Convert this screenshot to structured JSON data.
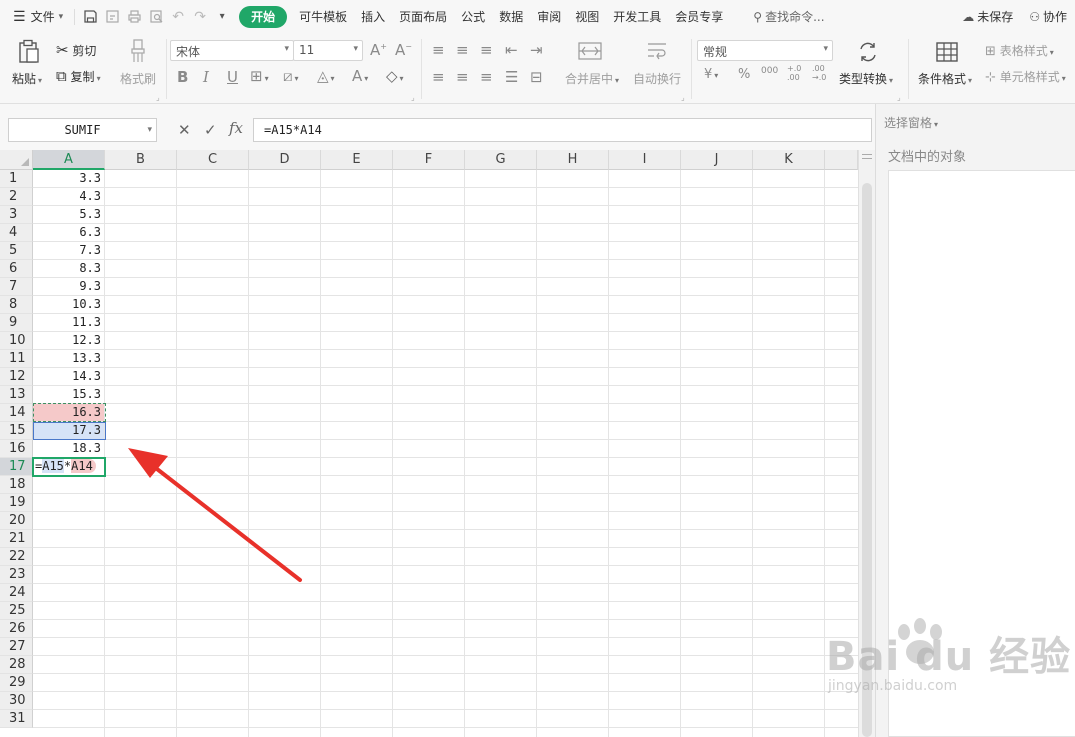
{
  "menu": {
    "file": "文件",
    "tabs": [
      "开始",
      "可牛模板",
      "插入",
      "页面布局",
      "公式",
      "数据",
      "审阅",
      "视图",
      "开发工具",
      "会员专享"
    ],
    "active_tab": "开始",
    "search": "查找命令...",
    "unsaved": "未保存",
    "collab": "协作"
  },
  "ribbon": {
    "paste": "粘贴",
    "cut": "剪切",
    "copy": "复制",
    "format_painter": "格式刷",
    "font_name": "宋体",
    "font_size": "11",
    "merge_center": "合并居中",
    "wrap_text": "自动换行",
    "number_format": "常规",
    "type_convert": "类型转换",
    "cond_format": "条件格式",
    "table_style": "表格样式",
    "cell_style": "单元格样式",
    "currency": "¥",
    "percent": "%",
    "thousands": "000",
    "inc_decimal": "+.0 .00",
    "dec_decimal": ".00 →.0"
  },
  "formula_bar": {
    "name_box": "SUMIF",
    "formula": "=A15*A14",
    "fx": "fx"
  },
  "sheet": {
    "columns": [
      "A",
      "B",
      "C",
      "D",
      "E",
      "F",
      "G",
      "H",
      "I",
      "J",
      "K"
    ],
    "rows": [
      "1",
      "2",
      "3",
      "4",
      "5",
      "6",
      "7",
      "8",
      "9",
      "10",
      "11",
      "12",
      "13",
      "14",
      "15",
      "16",
      "17",
      "18",
      "19",
      "20",
      "21",
      "22",
      "23",
      "24",
      "25",
      "26",
      "27",
      "28",
      "29",
      "30",
      "31"
    ],
    "colA_values": [
      "3.3",
      "4.3",
      "5.3",
      "6.3",
      "7.3",
      "8.3",
      "9.3",
      "10.3",
      "11.3",
      "12.3",
      "13.3",
      "14.3",
      "15.3",
      "16.3",
      "17.3",
      "18.3"
    ],
    "editing": {
      "eq": "=",
      "ref1": "A15",
      "op": "*",
      "ref2": "A14"
    },
    "selected_col": "A",
    "selected_row": "17"
  },
  "pane": {
    "title": "选择窗格",
    "subtitle": "文档中的对象"
  },
  "watermark": {
    "brand": "Bai du 经验",
    "url": "jingyan.baidu.com"
  },
  "colors": {
    "accent": "#20a768",
    "ref_red": "#f5c9c9",
    "ref_blue": "#d6e3f7",
    "arrow": "#e8312a"
  }
}
